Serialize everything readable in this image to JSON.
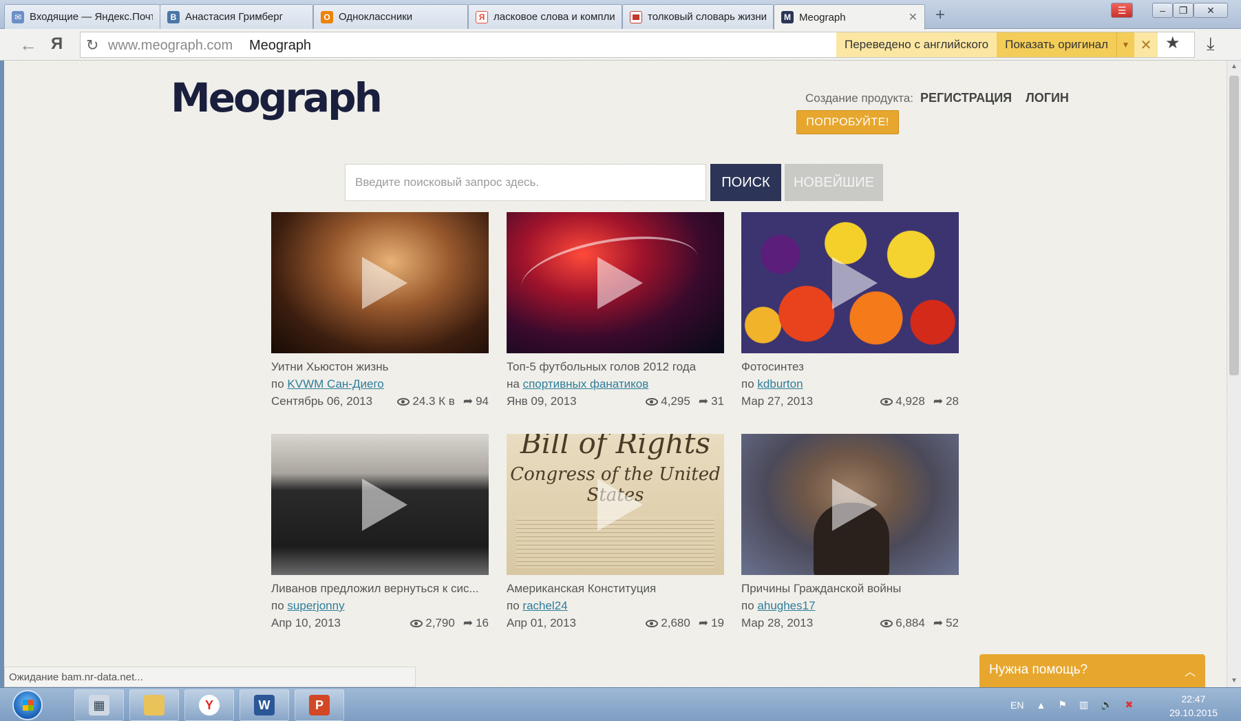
{
  "browser": {
    "tabs": [
      {
        "label": "Входящие — Яндекс.Почта",
        "icon": "mail-icon",
        "color": "#6c8fc7",
        "active": false
      },
      {
        "label": "Анастасия Гримберг",
        "icon": "vk-icon",
        "color": "#4a76a8",
        "active": false
      },
      {
        "label": "Одноклассники",
        "icon": "ok-icon",
        "color": "#ee8208",
        "active": false
      },
      {
        "label": "ласковое слова и комплименты",
        "icon": "yandex-icon",
        "color": "#e64b3b",
        "active": false
      },
      {
        "label": "толковый словарь жизни",
        "icon": "image-icon",
        "color": "#c0392b",
        "active": false
      },
      {
        "label": "Meograph",
        "icon": "meograph-icon",
        "color": "#2c3557",
        "active": true
      }
    ],
    "url_domain": "www.meograph.com",
    "url_title": "Meograph",
    "nav_ya": "Я",
    "translate": {
      "message": "Переведено с английского",
      "show_original": "Показать оригинал"
    }
  },
  "header": {
    "logo": "Meograph",
    "product_label": "Создание продукта:",
    "register": "РЕГИСТРАЦИЯ",
    "login": "ЛОГИН",
    "try_button": "ПОПРОБУЙТЕ!"
  },
  "search": {
    "placeholder": "Введите поисковый запрос здесь.",
    "search_button": "ПОИСК",
    "newest_button": "НОВЕЙШИЕ"
  },
  "cards": [
    {
      "title": "Уитни Хьюстон жизнь",
      "by": "по",
      "author": "KVWM Сан-Диего",
      "date": "Сентябрь 06, 2013",
      "views": "24.3 К в",
      "shares": "94"
    },
    {
      "title": "Топ-5 футбольных голов 2012 года",
      "by": "на",
      "author": "спортивных фанатиков",
      "date": "Янв 09, 2013",
      "views": "4,295",
      "shares": "31"
    },
    {
      "title": "Фотосинтез",
      "by": "по",
      "author": "kdburton",
      "date": "Мар 27, 2013",
      "views": "4,928",
      "shares": "28"
    },
    {
      "title": "Ливанов предложил вернуться к сис...",
      "by": "по",
      "author": "superjonny",
      "date": "Апр 10, 2013",
      "views": "2,790",
      "shares": "16"
    },
    {
      "title": "Американская Конституция",
      "by": "по",
      "author": "rachel24",
      "date": "Апр 01, 2013",
      "views": "2,680",
      "shares": "19"
    },
    {
      "title": "Причины Гражданской войны",
      "by": "по",
      "author": "ahughes17",
      "date": "Мар 28, 2013",
      "views": "6,884",
      "shares": "52"
    }
  ],
  "thumb_text": {
    "constitution_line1": "Bill of Rights",
    "constitution_line2": "Congress of the United States"
  },
  "status_text": "Ожидание bam.nr-data.net...",
  "help_label": "Нужна помощь?",
  "taskbar": {
    "language": "EN",
    "time": "22:47",
    "date": "29.10.2015"
  },
  "colors": {
    "accent_orange": "#e7a72e",
    "navy": "#2c3557",
    "link": "#2e7d9a"
  }
}
